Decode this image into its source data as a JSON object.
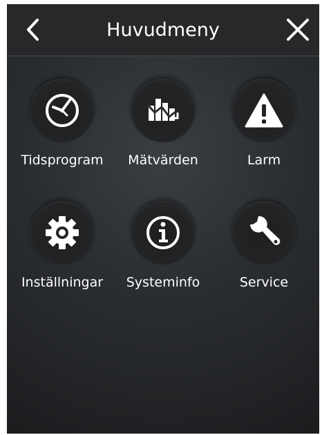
{
  "header": {
    "title": "Huvudmeny",
    "back_icon": "chevron-left-icon",
    "close_icon": "close-icon"
  },
  "menu": {
    "items": [
      {
        "label": "Tidsprogram",
        "icon": "clock-icon"
      },
      {
        "label": "Mätvärden",
        "icon": "chart-icon"
      },
      {
        "label": "Larm",
        "icon": "warning-icon"
      },
      {
        "label": "Inställningar",
        "icon": "gear-icon"
      },
      {
        "label": "Systeminfo",
        "icon": "info-icon"
      },
      {
        "label": "Service",
        "icon": "wrench-icon"
      }
    ]
  },
  "colors": {
    "background": "#2a2d30",
    "header": "#26282a",
    "text": "#ffffff"
  }
}
